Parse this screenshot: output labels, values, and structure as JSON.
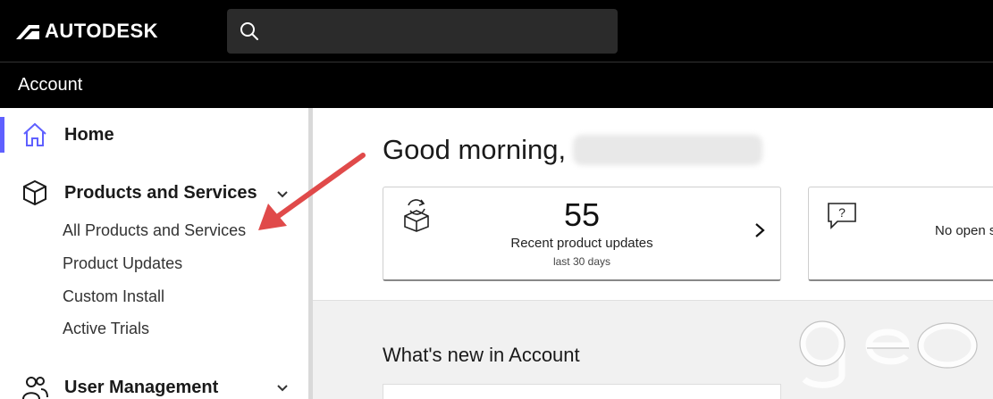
{
  "header": {
    "brand": "AUTODESK",
    "search_placeholder": ""
  },
  "subheader": {
    "title": "Account"
  },
  "sidebar": {
    "items": [
      {
        "label": "Home",
        "icon": "home-icon",
        "active": true
      },
      {
        "label": "Products and Services",
        "icon": "box-icon",
        "expanded": true,
        "children": [
          {
            "label": "All Products and Services"
          },
          {
            "label": "Product Updates"
          },
          {
            "label": "Custom Install"
          },
          {
            "label": "Active Trials"
          }
        ]
      },
      {
        "label": "User Management",
        "icon": "users-icon",
        "expanded": false
      }
    ]
  },
  "main": {
    "greeting": "Good morning,",
    "cards": [
      {
        "count": "55",
        "label": "Recent product updates",
        "sub": "last 30 days",
        "icon": "product-update-icon"
      },
      {
        "label": "No open s",
        "icon": "support-question-icon"
      }
    ],
    "whats_new_title": "What's new in Account"
  },
  "colors": {
    "accent": "#5f60ff",
    "annotation_arrow": "#e04a4a",
    "topbar": "#000000"
  }
}
